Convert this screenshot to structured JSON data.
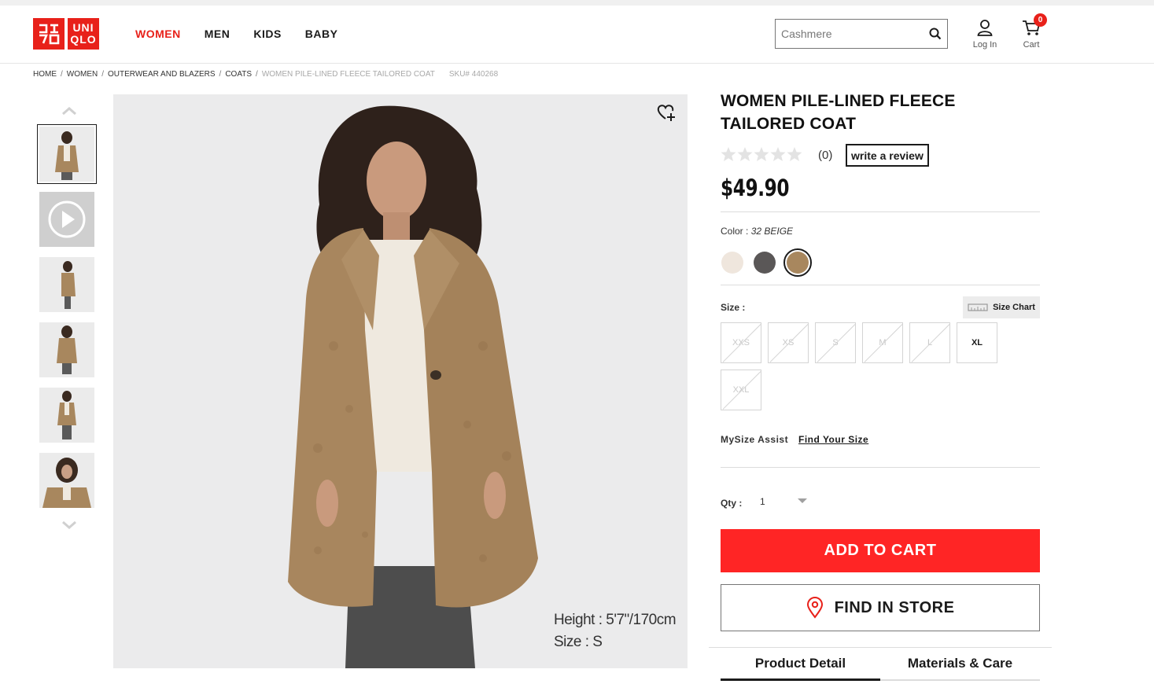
{
  "brand": {
    "logo_left": "ユニクロ",
    "logo_right_top": "UNI",
    "logo_right_bottom": "QLO",
    "color": "#e8211a"
  },
  "nav": {
    "items": [
      {
        "label": "WOMEN",
        "active": true
      },
      {
        "label": "MEN",
        "active": false
      },
      {
        "label": "KIDS",
        "active": false
      },
      {
        "label": "BABY",
        "active": false
      }
    ]
  },
  "search": {
    "placeholder": "Cashmere",
    "icon": "search-icon"
  },
  "account": {
    "login_label": "Log In",
    "cart_label": "Cart",
    "cart_count": "0"
  },
  "breadcrumb": {
    "items": [
      "HOME",
      "WOMEN",
      "OUTERWEAR AND BLAZERS",
      "COATS"
    ],
    "current": "WOMEN PILE-LINED FLEECE TAILORED COAT",
    "sku": "SKU# 440268"
  },
  "gallery": {
    "model_height": "Height : 5'7\"/170cm",
    "model_size": "Size : S"
  },
  "product": {
    "title": "WOMEN PILE-LINED FLEECE TAILORED COAT",
    "rating_count": "(0)",
    "write_review": "write a review",
    "price": "$49.90",
    "color_label": "Color :",
    "color_value": "32 BEIGE",
    "colors": [
      "#efe6dd",
      "#5a5757",
      "#a8875e"
    ],
    "selected_color": 2,
    "size_label": "Size :",
    "size_chart": "Size Chart",
    "sizes": [
      {
        "label": "XXS",
        "available": false
      },
      {
        "label": "XS",
        "available": false
      },
      {
        "label": "S",
        "available": false
      },
      {
        "label": "M",
        "available": false
      },
      {
        "label": "L",
        "available": false
      },
      {
        "label": "XL",
        "available": true
      },
      {
        "label": "XXL",
        "available": false
      }
    ],
    "mysize_label": "MySize Assist",
    "find_size": "Find Your Size",
    "qty_label": "Qty :",
    "qty_value": "1",
    "add_to_cart": "ADD TO CART",
    "find_in_store": "FIND IN STORE"
  },
  "tabs": {
    "detail": "Product Detail",
    "materials": "Materials & Care"
  }
}
